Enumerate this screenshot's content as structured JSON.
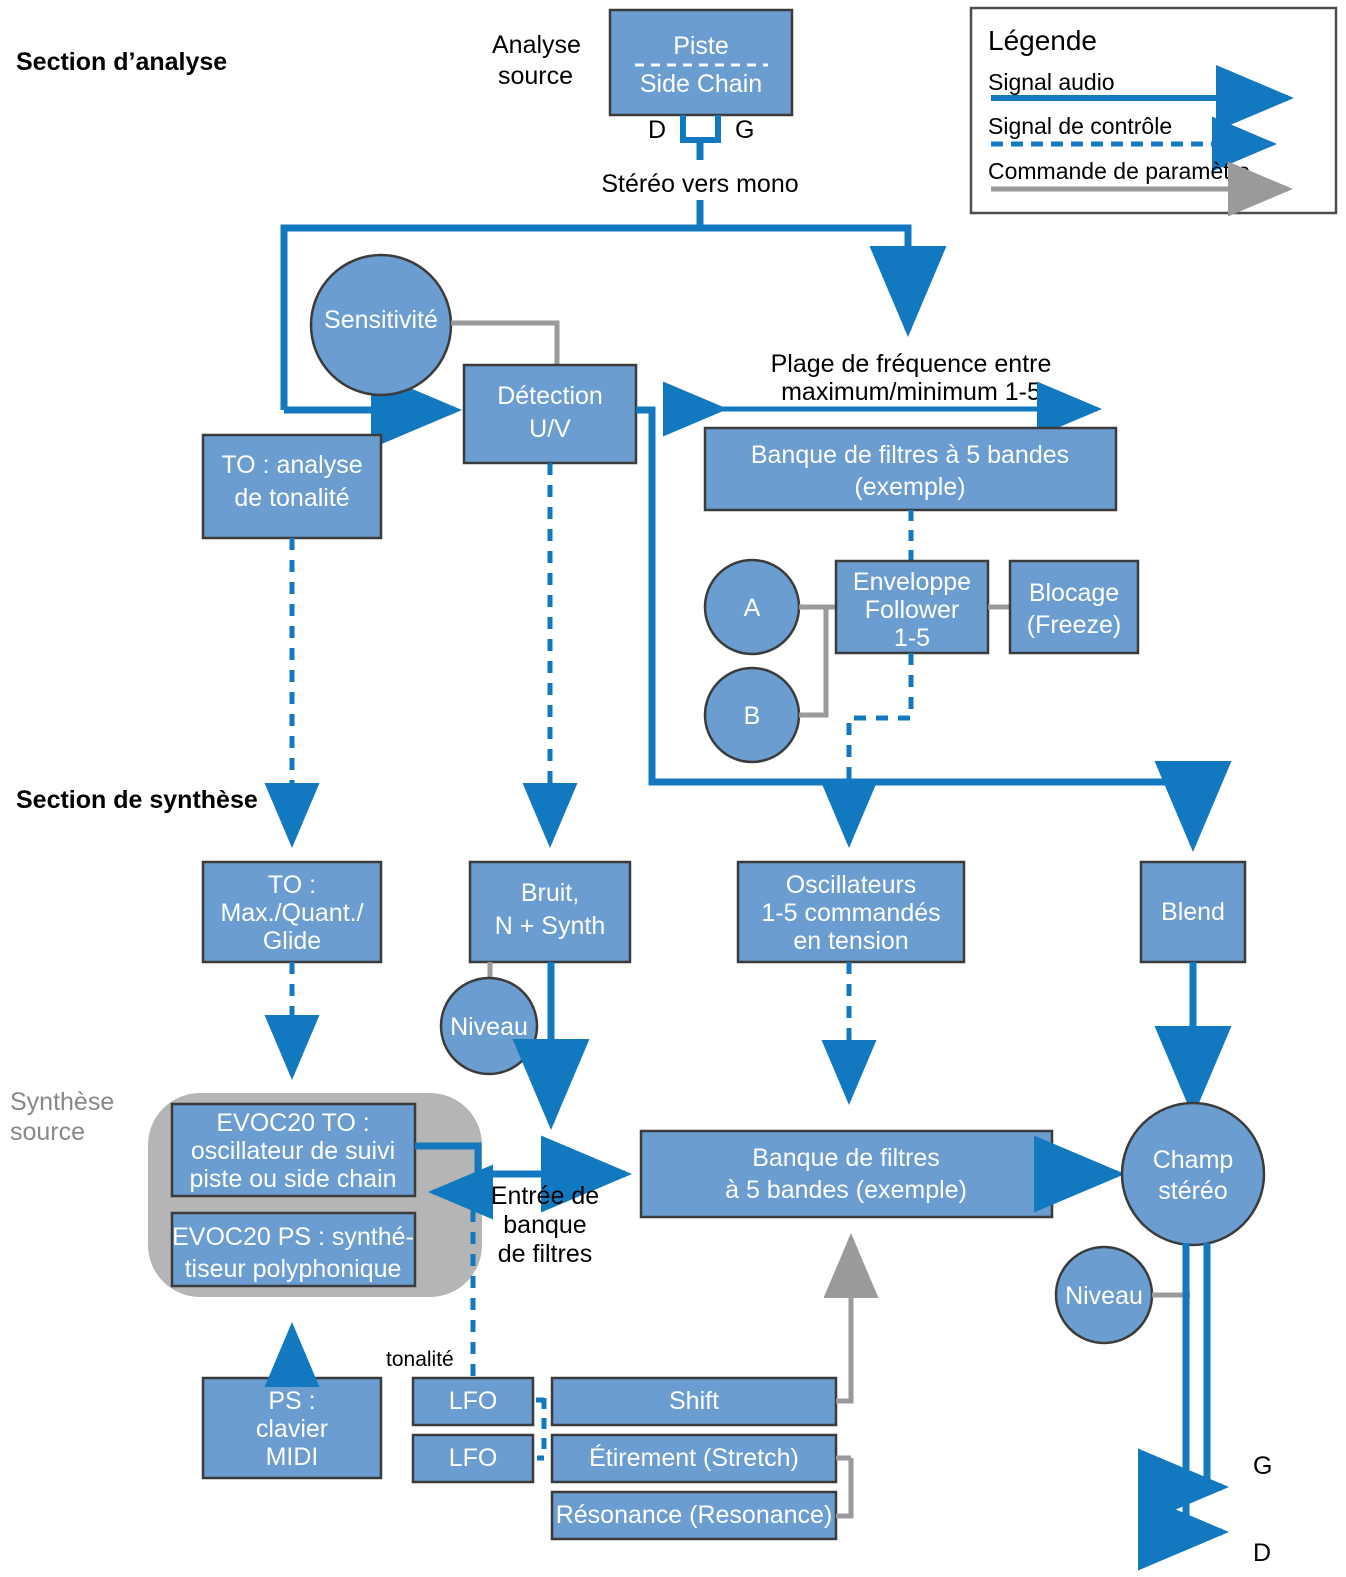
{
  "colors": {
    "box_fill": "#6b9dd1",
    "box_stroke": "#3b3b3b",
    "audio_signal": "#1278bf",
    "control_signal": "#1278bf",
    "parameter_control": "#9a9a9a",
    "group_fill": "#b5b5b5",
    "text_on_box": "#ffffff",
    "text_plain": "#000000",
    "gray_label": "#888888"
  },
  "sections": {
    "analysis_title": "Section d’analyse",
    "synthesis_title": "Section de synthèse",
    "synth_source_label_line1": "Synthèse",
    "synth_source_label_line2": "source"
  },
  "legend": {
    "title": "Légende",
    "items": [
      {
        "label": "Signal audio",
        "style": "solid",
        "color": "#1278bf"
      },
      {
        "label": "Signal de contrôle",
        "style": "dashed",
        "color": "#1278bf"
      },
      {
        "label": "Commande de paramètre",
        "style": "solid",
        "color": "#9a9a9a"
      }
    ]
  },
  "source": {
    "caption_line1": "Analyse",
    "caption_line2": "source",
    "box_line1": "Piste",
    "box_line2": "Side Chain",
    "channel_right": "D",
    "channel_left": "G",
    "downmix_label": "Stéréo vers mono"
  },
  "analysis": {
    "sensitivity": "Sensitivité",
    "detection_line1": "Détection",
    "detection_line2": "U/V",
    "pitch_analysis_line1": "TO : analyse",
    "pitch_analysis_line2": "de tonalité",
    "freq_range_line1": "Plage de fréquence entre",
    "freq_range_line2": "maximum/minimum 1-5",
    "filter_bank_line1": "Banque de filtres à 5 bandes",
    "filter_bank_line2": "(exemple)",
    "knob_a": "A",
    "knob_b": "B",
    "env_follower_line1": "Enveloppe",
    "env_follower_line2": "Follower",
    "env_follower_line3": "1-5",
    "freeze_line1": "Blocage",
    "freeze_line2": "(Freeze)"
  },
  "synthesis": {
    "pitch_proc_line1": "TO :",
    "pitch_proc_line2": "Max./Quant./",
    "pitch_proc_line3": "Glide",
    "noise_line1": "Bruit,",
    "noise_line2": "N + Synth",
    "noise_level": "Niveau",
    "oscillators_line1": "Oscillateurs",
    "oscillators_line2": "1-5 commandés",
    "oscillators_line3": "en tension",
    "blend": "Blend",
    "evoc_to_line1": "EVOC20 TO :",
    "evoc_to_line2": "oscillateur de suivi",
    "evoc_to_line3": "piste ou side chain",
    "evoc_ps_line1": "EVOC20 PS : synthé-",
    "evoc_ps_line2": "tiseur polyphonique",
    "fb_input_line1": "Entrée de",
    "fb_input_line2": "banque",
    "fb_input_line3": "de filtres",
    "synth_filter_bank_line1": "Banque de filtres",
    "synth_filter_bank_line2": "à 5 bandes (exemple)",
    "stereo_field_line1": "Champ",
    "stereo_field_line2": "stéréo",
    "out_level": "Niveau",
    "out_left": "G",
    "out_right": "D",
    "midi_line1": "PS :",
    "midi_line2": "clavier",
    "midi_line3": "MIDI",
    "lfo_1": "LFO",
    "lfo_2": "LFO",
    "pitch_label": "tonalité",
    "shift": "Shift",
    "stretch": "Étirement (Stretch)",
    "resonance": "Résonance (Resonance)"
  }
}
